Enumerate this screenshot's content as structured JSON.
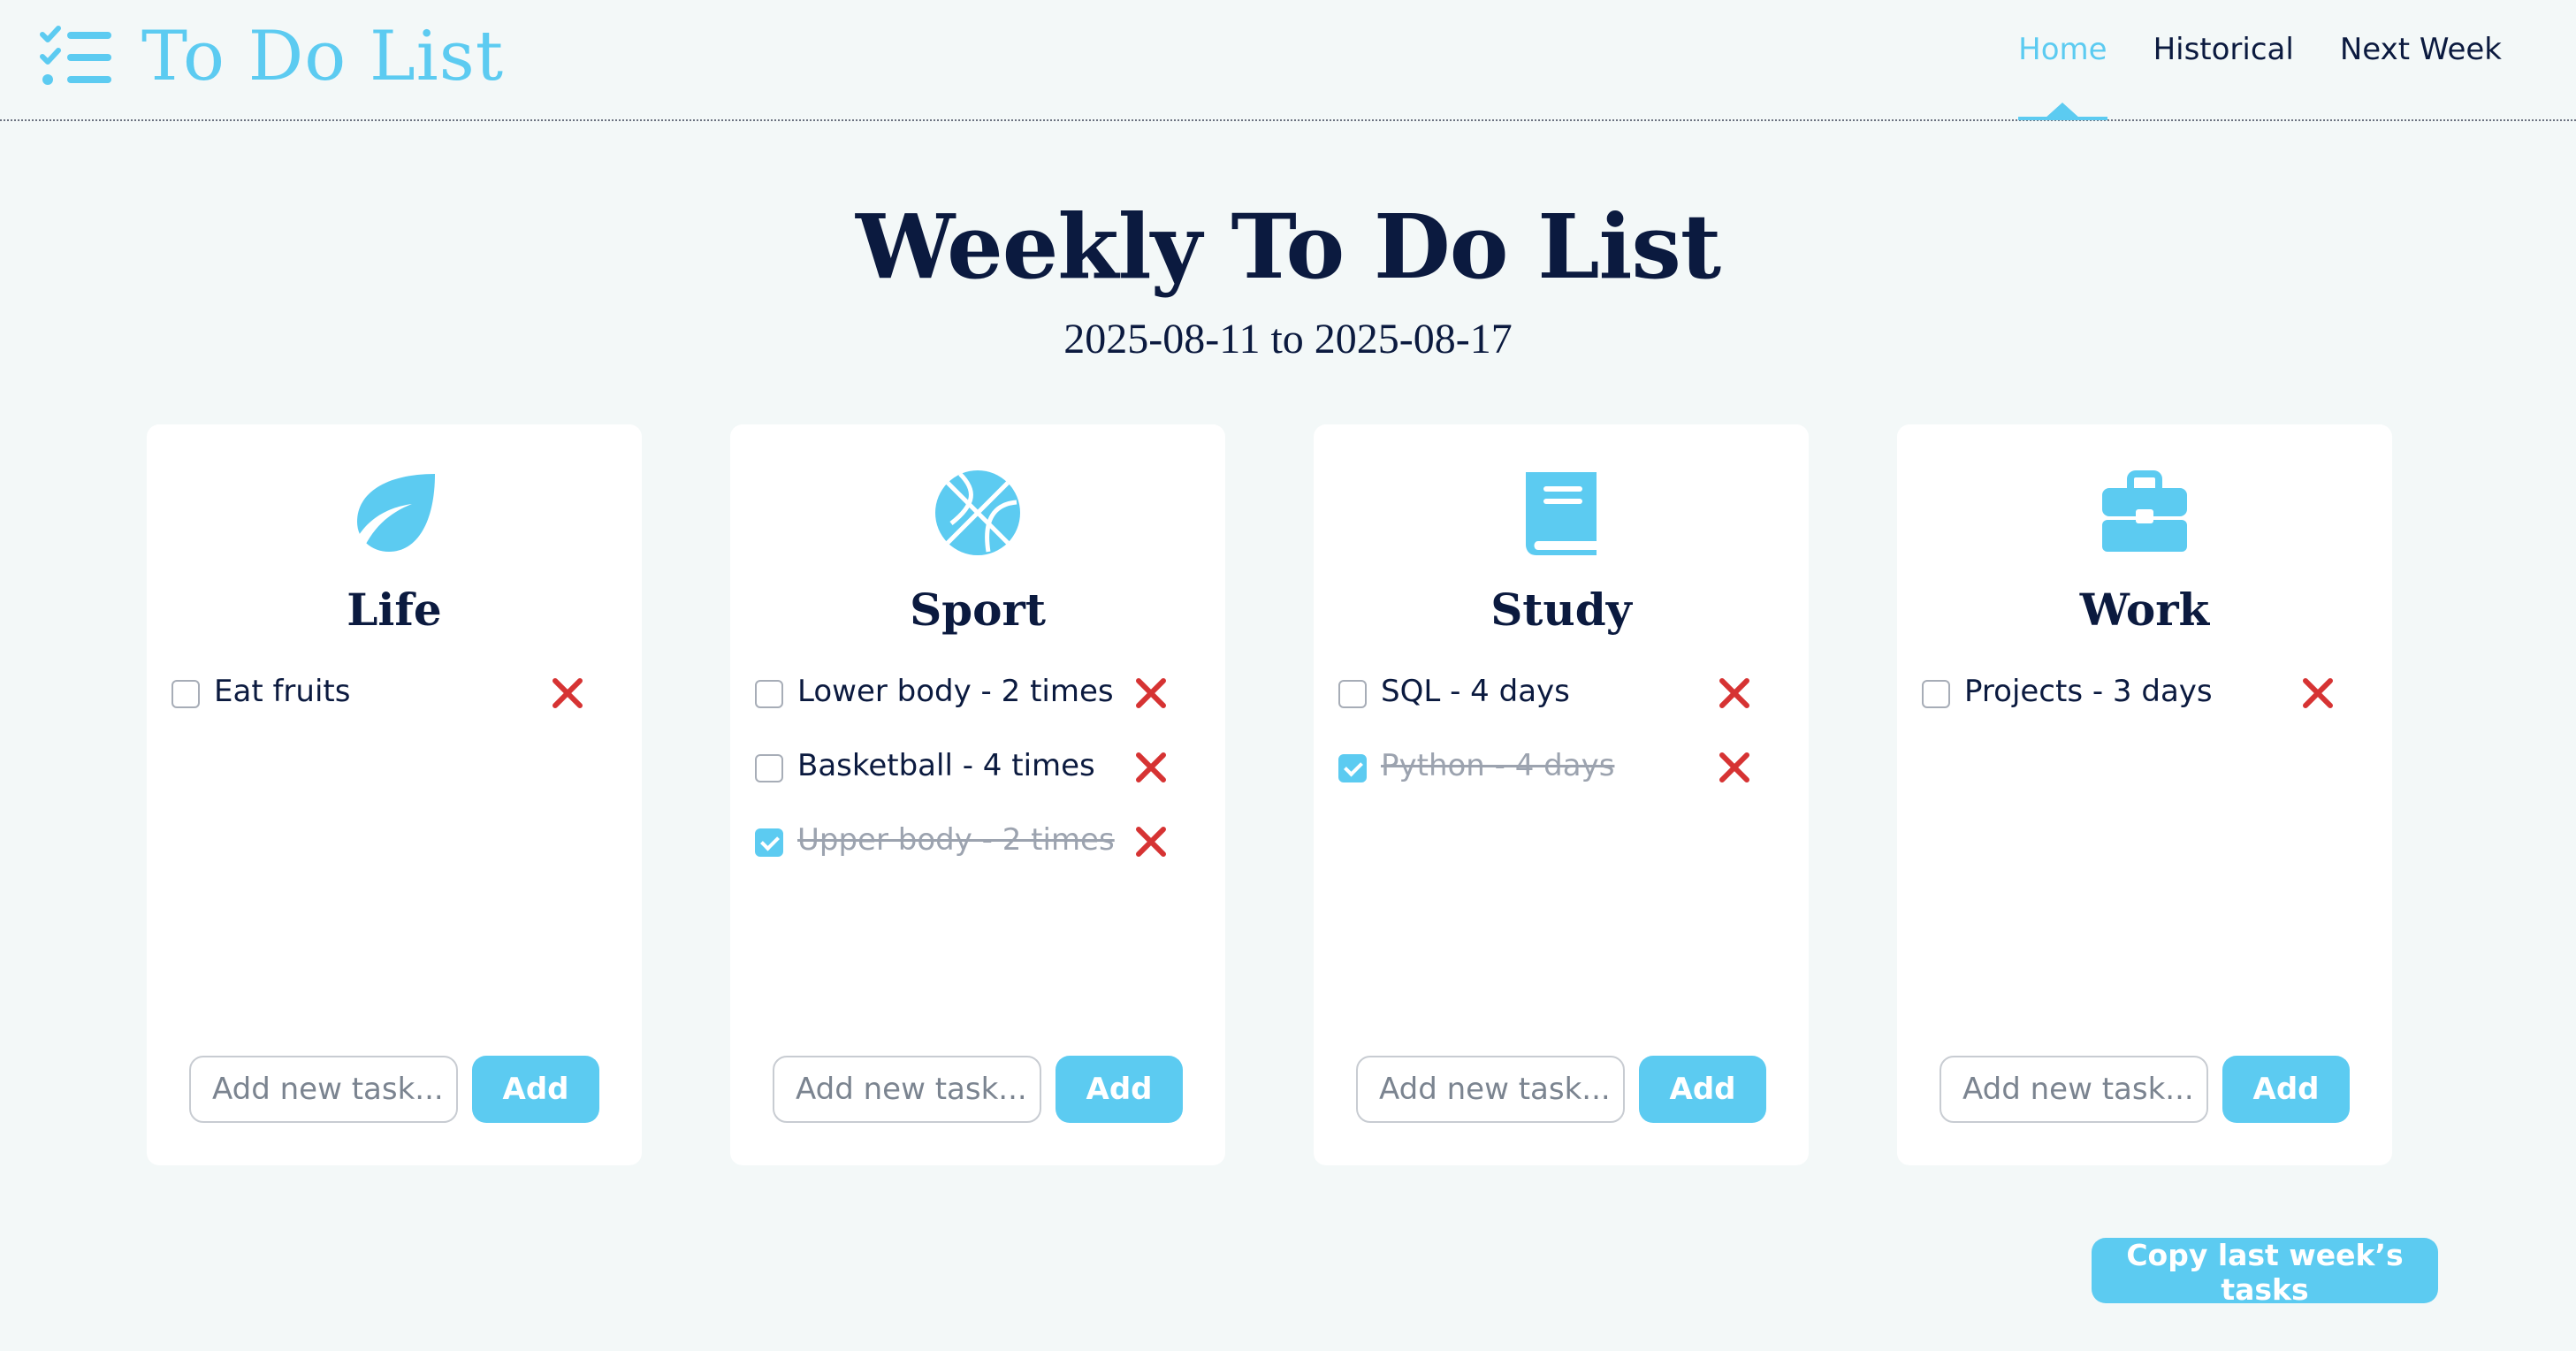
{
  "app": {
    "title": "To Do List",
    "icon": "checklist-icon"
  },
  "nav": {
    "items": [
      {
        "label": "Home",
        "active": true
      },
      {
        "label": "Historical",
        "active": false
      },
      {
        "label": "Next Week",
        "active": false
      }
    ]
  },
  "page": {
    "title": "Weekly To Do List",
    "date_range": "2025-08-11 to 2025-08-17"
  },
  "colors": {
    "accent": "#5ccbf1",
    "heading": "#0b1a3f",
    "background": "#f3f8f8",
    "delete": "#d63333",
    "done_text": "#9ca3af"
  },
  "categories": [
    {
      "title": "Life",
      "icon": "leaf-icon",
      "tasks": [
        {
          "text": "Eat fruits",
          "done": false
        }
      ],
      "input_placeholder": "Add new task...",
      "add_label": "Add"
    },
    {
      "title": "Sport",
      "icon": "basketball-icon",
      "tasks": [
        {
          "text": "Lower body - 2 times",
          "done": false
        },
        {
          "text": "Basketball - 4 times",
          "done": false
        },
        {
          "text": "Upper body - 2 times",
          "done": true
        }
      ],
      "input_placeholder": "Add new task...",
      "add_label": "Add"
    },
    {
      "title": "Study",
      "icon": "book-icon",
      "tasks": [
        {
          "text": "SQL - 4 days",
          "done": false
        },
        {
          "text": "Python - 4 days",
          "done": true
        }
      ],
      "input_placeholder": "Add new task...",
      "add_label": "Add"
    },
    {
      "title": "Work",
      "icon": "briefcase-icon",
      "tasks": [
        {
          "text": "Projects - 3 days",
          "done": false
        }
      ],
      "input_placeholder": "Add new task...",
      "add_label": "Add"
    }
  ],
  "footer": {
    "copy_label": "Copy last week’s tasks"
  }
}
